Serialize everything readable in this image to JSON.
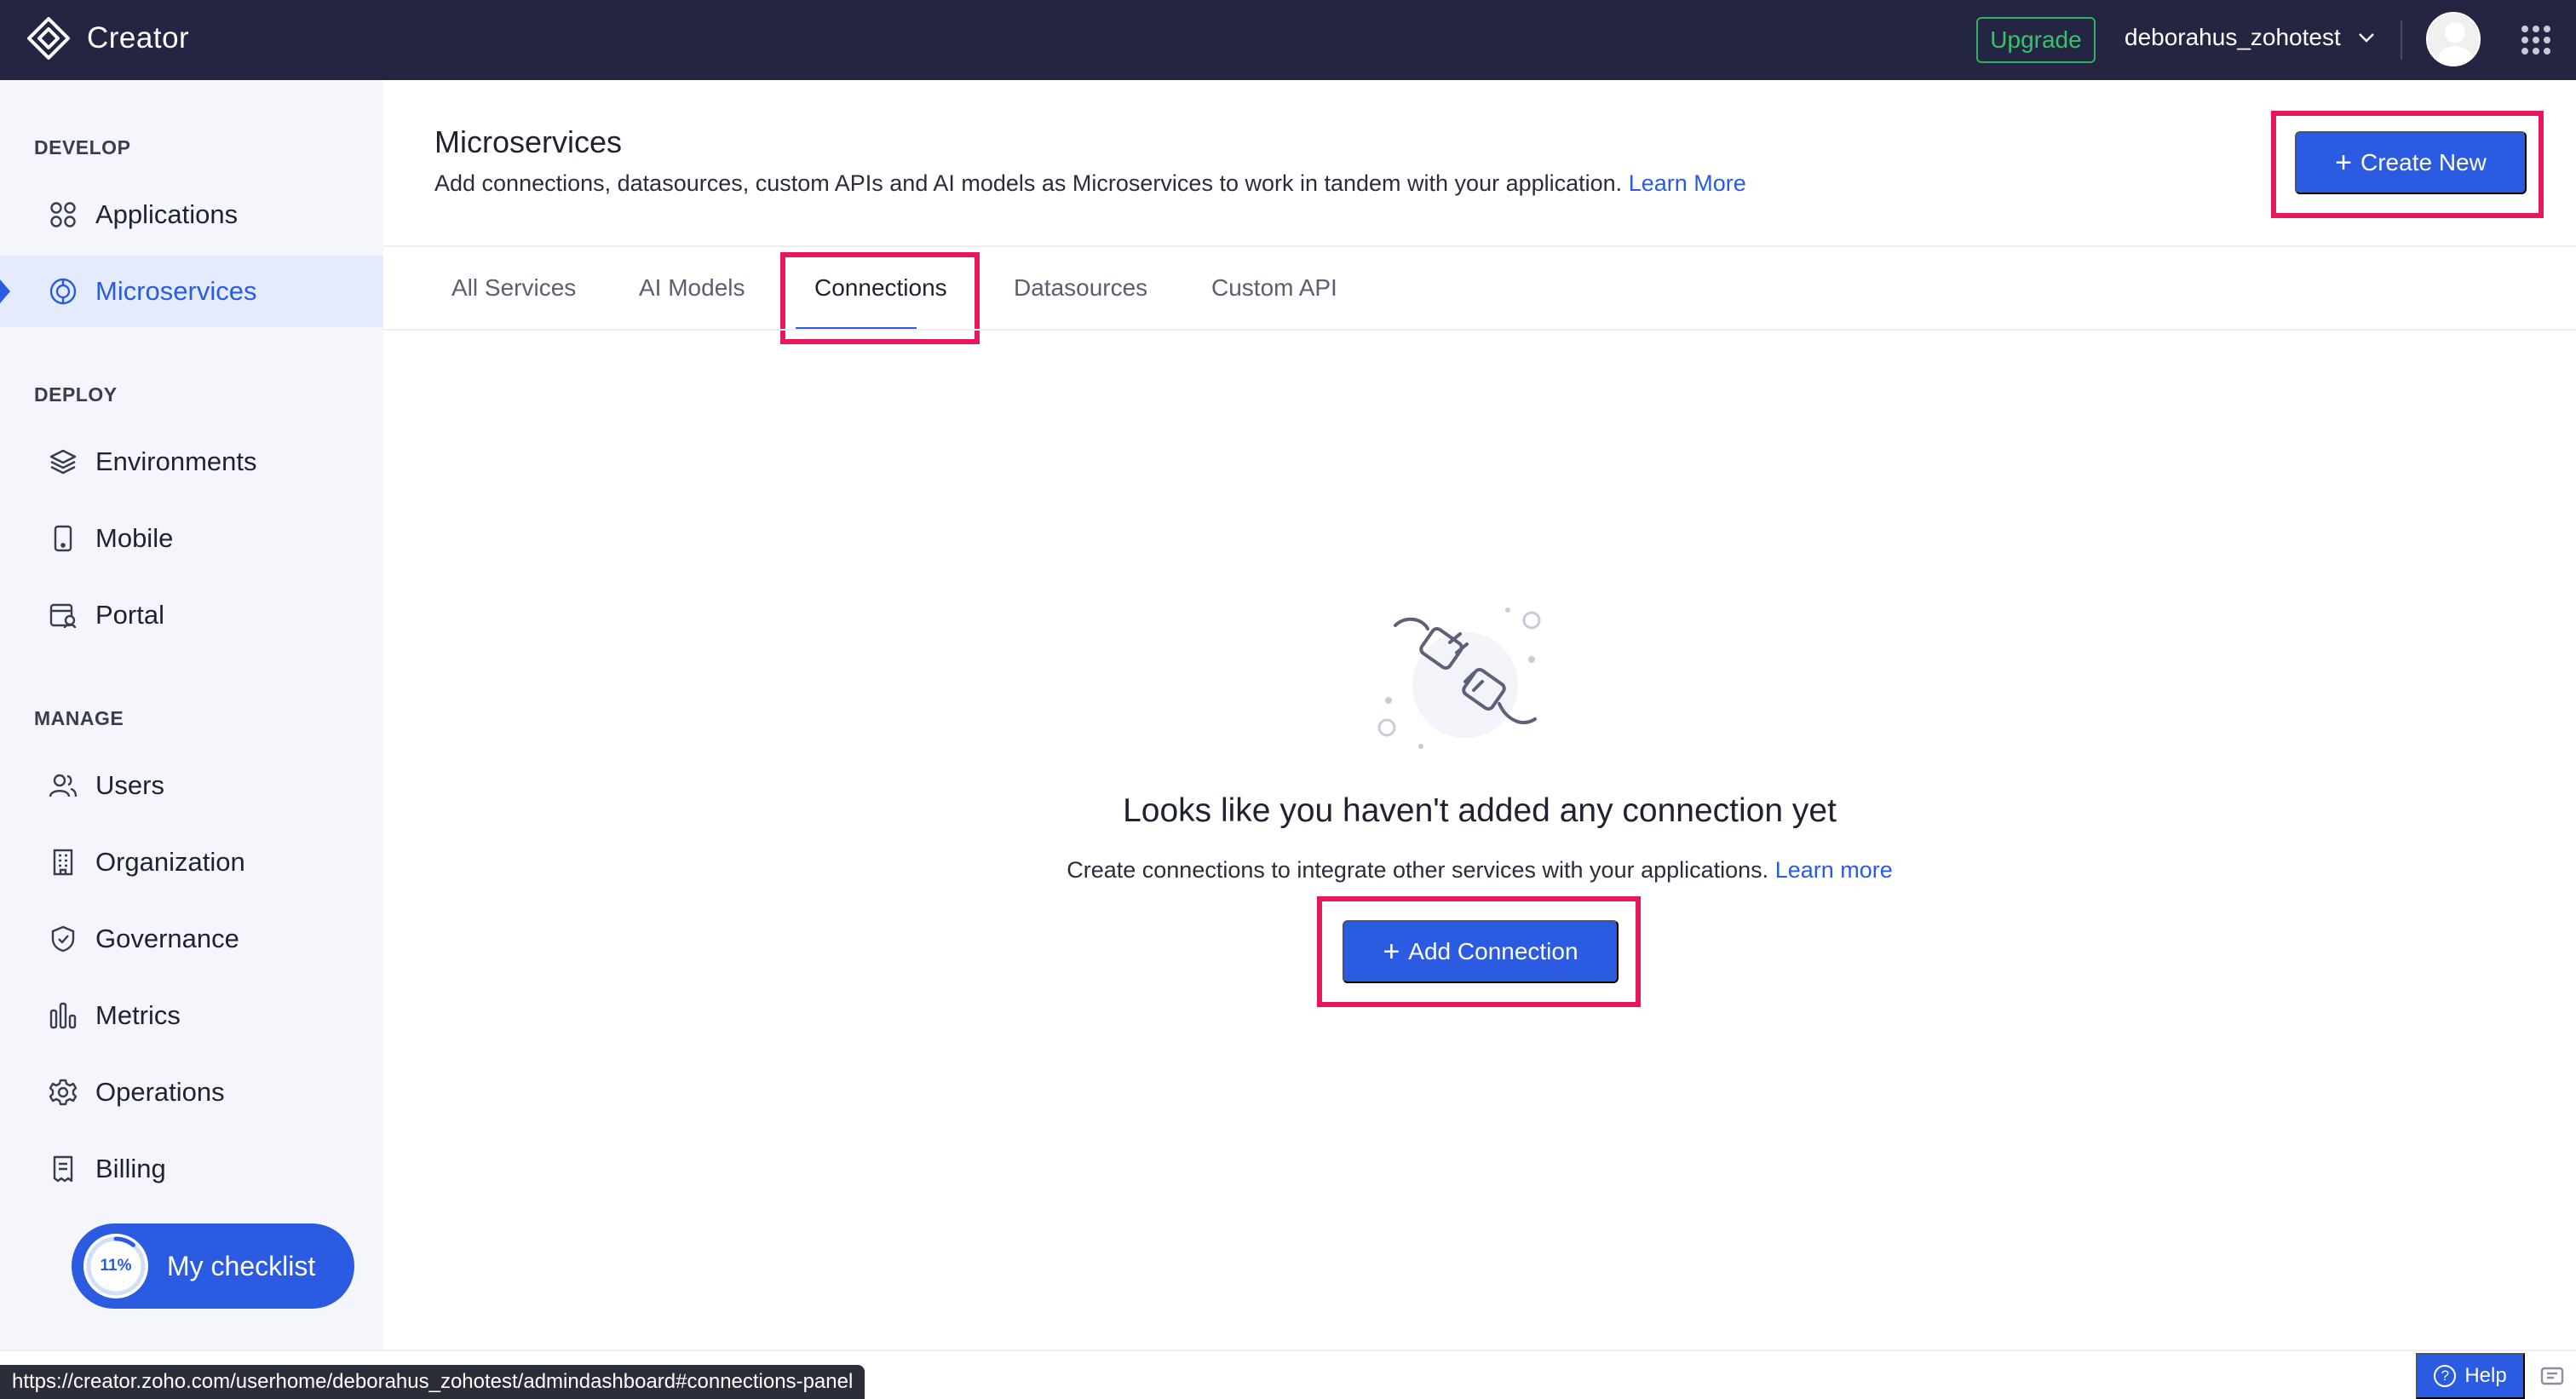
{
  "topbar": {
    "app_name": "Creator",
    "upgrade_label": "Upgrade",
    "username": "deborahus_zohotest"
  },
  "sidebar": {
    "sections": [
      {
        "label": "DEVELOP",
        "items": [
          {
            "label": "Applications",
            "icon": "apps-icon"
          },
          {
            "label": "Microservices",
            "icon": "microservices-icon",
            "active": true
          }
        ]
      },
      {
        "label": "DEPLOY",
        "items": [
          {
            "label": "Environments",
            "icon": "layers-icon"
          },
          {
            "label": "Mobile",
            "icon": "mobile-icon"
          },
          {
            "label": "Portal",
            "icon": "portal-icon"
          }
        ]
      },
      {
        "label": "MANAGE",
        "items": [
          {
            "label": "Users",
            "icon": "users-icon"
          },
          {
            "label": "Organization",
            "icon": "building-icon"
          },
          {
            "label": "Governance",
            "icon": "shield-icon"
          },
          {
            "label": "Metrics",
            "icon": "bar-chart-icon"
          },
          {
            "label": "Operations",
            "icon": "gear-icon"
          },
          {
            "label": "Billing",
            "icon": "receipt-icon"
          }
        ]
      }
    ],
    "checklist": {
      "label": "My checklist",
      "progress_percent": 11,
      "progress_text": "11%"
    }
  },
  "main": {
    "title": "Microservices",
    "description": "Add connections, datasources, custom APIs and AI models as Microservices to work in tandem with your application.",
    "learn_more": "Learn More",
    "create_new_label": "Create New",
    "tabs": [
      {
        "label": "All Services"
      },
      {
        "label": "AI Models"
      },
      {
        "label": "Connections",
        "active": true
      },
      {
        "label": "Datasources"
      },
      {
        "label": "Custom API"
      }
    ],
    "empty_state": {
      "title": "Looks like you haven't added any connection yet",
      "description": "Create connections to integrate other services with your applications.",
      "learn_more": "Learn more",
      "button_label": "Add Connection",
      "illustration": "plug-icon"
    }
  },
  "status_bar": {
    "url": "https://creator.zoho.com/userhome/deborahus_zohotest/admindashboard#connections-panel",
    "help_label": "Help"
  },
  "colors": {
    "topbar_bg": "#232542",
    "accent": "#2b5be0",
    "highlight_border": "#e8175d",
    "upgrade_green": "#38c26b",
    "sidebar_bg": "#f4f6fc"
  }
}
